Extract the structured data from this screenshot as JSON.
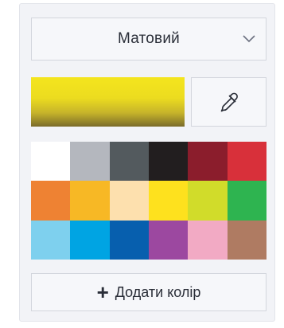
{
  "finish_dropdown": {
    "selected": "Матовий",
    "icon": "chevron-down-icon"
  },
  "current_color": {
    "top": "#f4e51e",
    "bottom": "#7a6b2a"
  },
  "eyedropper": {
    "icon": "eyedropper-icon"
  },
  "palette": {
    "colors": [
      "#ffffff",
      "#b4b7be",
      "#535a5e",
      "#221e1f",
      "#8b1d2c",
      "#d8303a",
      "#ee8233",
      "#f7b825",
      "#fde0ae",
      "#fee11e",
      "#d1dc2a",
      "#2eb450",
      "#7ed0ee",
      "#00a4e3",
      "#075fae",
      "#9c48a0",
      "#f2aac4",
      "#af7b62"
    ]
  },
  "add_color": {
    "label": "Додати колір",
    "icon": "plus-icon"
  }
}
